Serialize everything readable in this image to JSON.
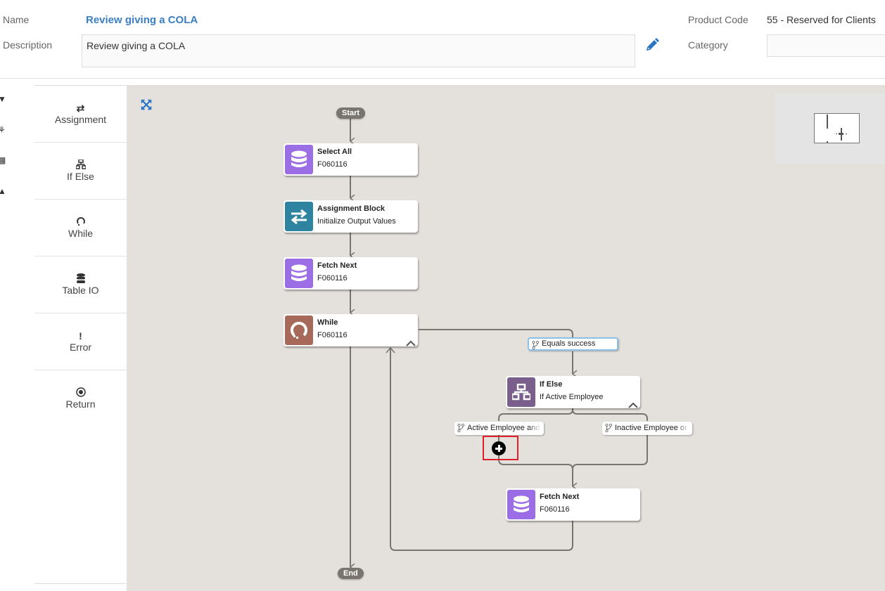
{
  "header": {
    "name_label": "Name",
    "name_value": "Review giving a COLA",
    "description_label": "Description",
    "description_value": "Review giving a COLA",
    "product_code_label": "Product Code",
    "product_code_value": "55 - Reserved for Clients",
    "category_label": "Category",
    "category_value": ""
  },
  "palette": {
    "items": [
      {
        "label": "Assignment",
        "icon": "exchange-arrows-icon"
      },
      {
        "label": "If Else",
        "icon": "sitemap-icon"
      },
      {
        "label": "While",
        "icon": "loop-icon"
      },
      {
        "label": "Table IO",
        "icon": "database-icon"
      },
      {
        "label": "Error",
        "icon": "exclamation-icon"
      },
      {
        "label": "Return",
        "icon": "dot-circle-icon"
      }
    ]
  },
  "flow": {
    "start_label": "Start",
    "end_label": "End",
    "nodes": [
      {
        "title": "Select All",
        "subtitle": "F060116",
        "type": "table-io",
        "color": "#9b6ee6"
      },
      {
        "title": "Assignment Block",
        "subtitle": "Initialize Output Values",
        "type": "assignment",
        "color": "#2e84a0"
      },
      {
        "title": "Fetch Next",
        "subtitle": "F060116",
        "type": "table-io",
        "color": "#9b6ee6"
      },
      {
        "title": "While",
        "subtitle": "F060116",
        "type": "while",
        "color": "#a76a5a"
      },
      {
        "title": "If Else",
        "subtitle": "If Active Employee",
        "type": "if-else",
        "color": "#7a5f8c"
      },
      {
        "title": "Fetch Next",
        "subtitle": "F060116",
        "type": "table-io",
        "color": "#9b6ee6"
      }
    ],
    "conditions": {
      "while_condition": "Equals success",
      "branch_true": "Active Employee and",
      "branch_false": "Inactive Employee or"
    }
  },
  "colors": {
    "accent": "#3a7ec4",
    "canvas": "#e4e1dd",
    "highlight": "#e0202a"
  }
}
